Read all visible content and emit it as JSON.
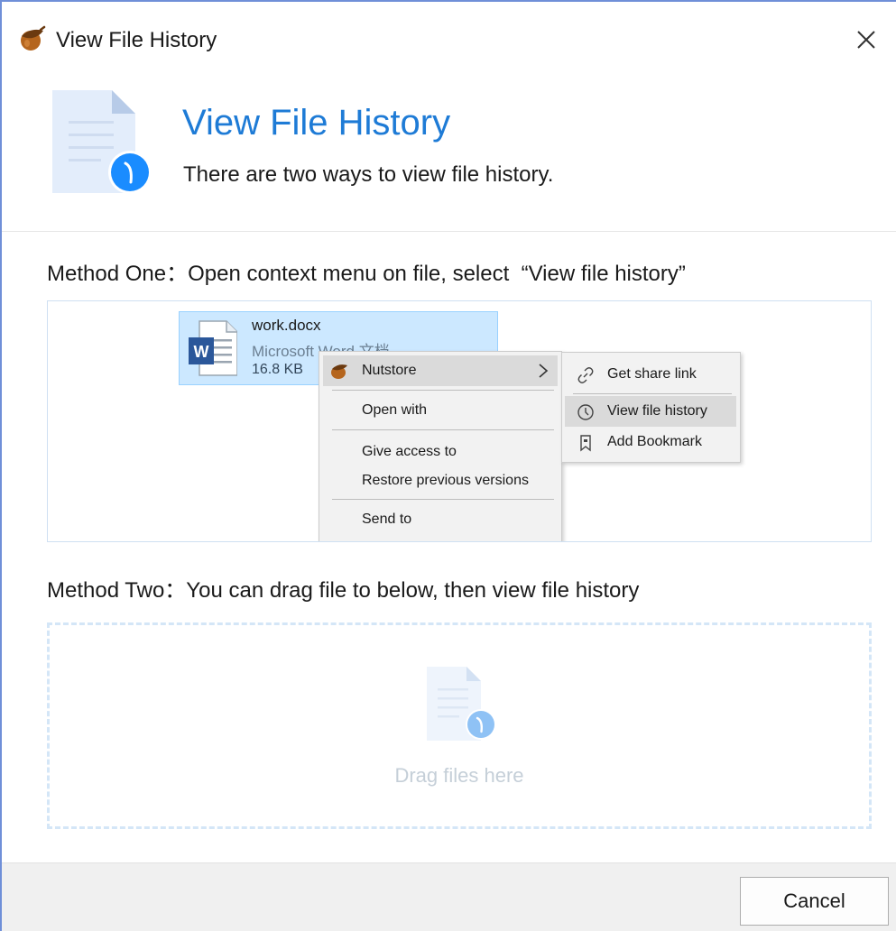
{
  "window": {
    "title": "View File History",
    "close_glyph": "✕"
  },
  "header": {
    "title": "View File History",
    "subtitle": "There are two ways to view file history.",
    "icon": "file-history-icon"
  },
  "method_one": {
    "label": "Method One：Open context menu on file, select  “View file history”",
    "file": {
      "name": "work.docx",
      "type": "Microsoft Word 文档",
      "size": "16.8 KB",
      "icon": "word-document-icon"
    },
    "context_menu": {
      "items": [
        {
          "label": "Nutstore",
          "icon": "nutstore-acorn-icon",
          "has_submenu": true,
          "highlighted": true
        },
        {
          "label": "Open with"
        },
        {
          "label": "Give access to"
        },
        {
          "label": "Restore previous versions"
        },
        {
          "label": "Send to"
        }
      ]
    },
    "submenu": {
      "items": [
        {
          "label": "Get share link",
          "icon": "link-icon"
        },
        {
          "label": "View file history",
          "icon": "clock-icon",
          "highlighted": true
        },
        {
          "label": "Add Bookmark",
          "icon": "bookmark-icon"
        }
      ]
    }
  },
  "method_two": {
    "label": "Method Two：You can drag file to below, then view file history",
    "drop_text": "Drag files here"
  },
  "footer": {
    "cancel_label": "Cancel"
  },
  "colors": {
    "accent": "#1e7bd6",
    "badge_blue": "#1a8cff",
    "selection": "#cce8ff",
    "window_border": "#6f8fd8"
  }
}
